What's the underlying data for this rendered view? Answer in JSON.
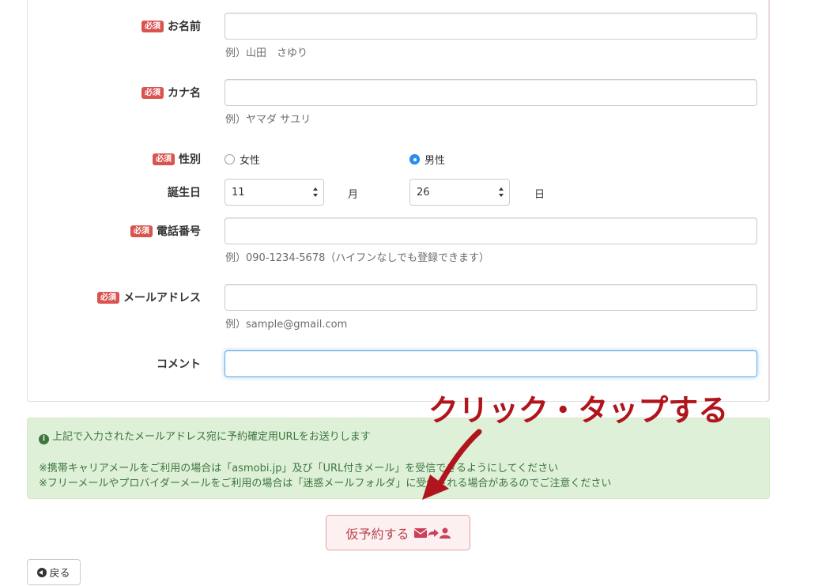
{
  "form": {
    "required_badge": "必須",
    "name": {
      "label": "お名前",
      "value": "",
      "hint": "例）山田　さゆり"
    },
    "kana": {
      "label": "カナ名",
      "value": "",
      "hint": "例）ヤマダ サユリ"
    },
    "gender": {
      "label": "性別",
      "options": [
        "女性",
        "男性"
      ],
      "selected": "男性"
    },
    "birthday": {
      "label": "誕生日",
      "month_value": "11",
      "month_unit": "月",
      "day_value": "26",
      "day_unit": "日"
    },
    "phone": {
      "label": "電話番号",
      "value": "",
      "hint": "例）090-1234-5678（ハイフンなしでも登録できます）"
    },
    "email": {
      "label": "メールアドレス",
      "value": "",
      "hint": "例）sample@gmail.com"
    },
    "comment": {
      "label": "コメント",
      "value": ""
    }
  },
  "notice": {
    "line1": "上記で入力されたメールアドレス宛に予約確定用URLをお送りします",
    "line2": "※携帯キャリアメールをご利用の場合は「asmobi.jp」及び「URL付きメール」を受信できるようにしてください",
    "line3": "※フリーメールやプロバイダーメールをご利用の場合は「迷惑メールフォルダ」に受信される場合があるのでご注意ください"
  },
  "annotation": "クリック・タップする",
  "actions": {
    "submit_label": "仮予約する",
    "back_label": "戻る"
  },
  "colors": {
    "required": "#d9534f",
    "alert_bg": "#dff0d8",
    "alert_text": "#3c763d",
    "annotation": "#b0151d",
    "submit_text": "#b8434e",
    "radio_checked": "#2b8ef3"
  },
  "icons": {
    "info": "info-circle-icon",
    "arrow": "curved-arrow-icon",
    "submit": [
      "envelope-icon",
      "share-arrow-icon",
      "user-icon"
    ],
    "back": "circle-arrow-left-icon"
  }
}
